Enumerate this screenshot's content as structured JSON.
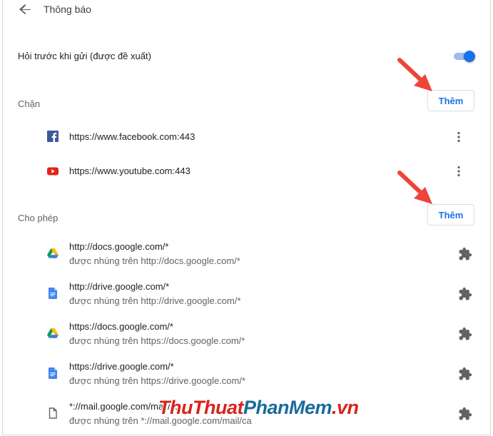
{
  "header": {
    "title": "Thông báo"
  },
  "ask_before_sending": {
    "label": "Hỏi trước khi gửi (được đề xuất)",
    "enabled": true
  },
  "blocked": {
    "title": "Chặn",
    "add_label": "Thêm",
    "items": [
      {
        "url": "https://www.facebook.com:443",
        "icon": "facebook-icon"
      },
      {
        "url": "https://www.youtube.com:443",
        "icon": "youtube-icon"
      }
    ]
  },
  "allowed": {
    "title": "Cho phép",
    "add_label": "Thêm",
    "items": [
      {
        "url": "http://docs.google.com/*",
        "sub": "được nhúng trên http://docs.google.com/*",
        "icon": "google-drive-icon"
      },
      {
        "url": "http://drive.google.com/*",
        "sub": "được nhúng trên http://drive.google.com/*",
        "icon": "google-docs-icon"
      },
      {
        "url": "https://docs.google.com/*",
        "sub": "được nhúng trên https://docs.google.com/*",
        "icon": "google-drive-icon"
      },
      {
        "url": "https://drive.google.com/*",
        "sub": "được nhúng trên https://drive.google.com/*",
        "icon": "google-docs-icon"
      },
      {
        "url": "*://mail.google.com/mail/ca",
        "sub": "được nhúng trên *://mail.google.com/mail/ca",
        "icon": "file-icon"
      }
    ]
  },
  "watermark": {
    "part1": "ThuThuat",
    "part2": "PhanMem",
    "part3": ".vn"
  },
  "colors": {
    "accent": "#1a73e8",
    "arrow": "#f0433a",
    "facebook": "#3b5998",
    "youtube": "#e62117"
  }
}
